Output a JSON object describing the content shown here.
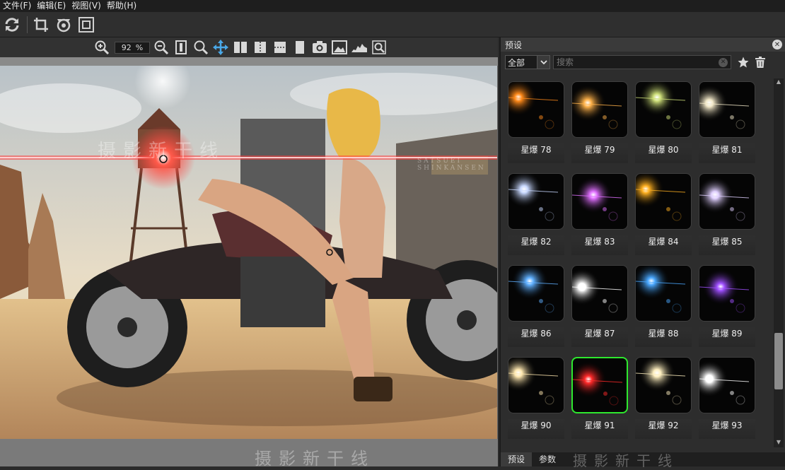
{
  "menu": [
    "文件(F)",
    "编辑(E)",
    "视图(V)",
    "帮助(H)"
  ],
  "toolbar": {
    "refresh_icon": "refresh-icon",
    "crop_icon": "crop-icon",
    "rotate_icon": "rotate-icon",
    "fit_icon": "fit-screen-icon"
  },
  "viewbar": {
    "zoom_value": "92",
    "zoom_unit": "%"
  },
  "canvas": {
    "watermark_main": "摄影新干线",
    "watermark_sub": "SATSUEI SHINKANSEN"
  },
  "panel": {
    "title": "预设",
    "close": "✕",
    "category": "全部",
    "search_placeholder": "搜索",
    "presets": [
      {
        "label": "星爆 78",
        "color": "#ff8a1a"
      },
      {
        "label": "星爆 79",
        "color": "#ffb24a"
      },
      {
        "label": "星爆 80",
        "color": "#cfe07a"
      },
      {
        "label": "星爆 81",
        "color": "#f2e8c8"
      },
      {
        "label": "星爆 82",
        "color": "#c8d8ff"
      },
      {
        "label": "星爆 83",
        "color": "#e070ff"
      },
      {
        "label": "星爆 84",
        "color": "#ffb020"
      },
      {
        "label": "星爆 85",
        "color": "#e0d0ff"
      },
      {
        "label": "星爆 86",
        "color": "#60b0ff"
      },
      {
        "label": "星爆 87",
        "color": "#ffffff"
      },
      {
        "label": "星爆 88",
        "color": "#4aa8ff"
      },
      {
        "label": "星爆 89",
        "color": "#a050ff"
      },
      {
        "label": "星爆 90",
        "color": "#ffe8b0"
      },
      {
        "label": "星爆 91",
        "color": "#ff2a2a"
      },
      {
        "label": "星爆 92",
        "color": "#fff0c0"
      },
      {
        "label": "星爆 93",
        "color": "#ffffff"
      }
    ],
    "selected_preset": "星爆 91",
    "tabs": [
      "预设",
      "参数"
    ],
    "active_tab": "预设",
    "footer_watermark": "摄影新干线"
  },
  "colors": {
    "selection": "#2ee82e",
    "background": "#2b2b2b"
  }
}
